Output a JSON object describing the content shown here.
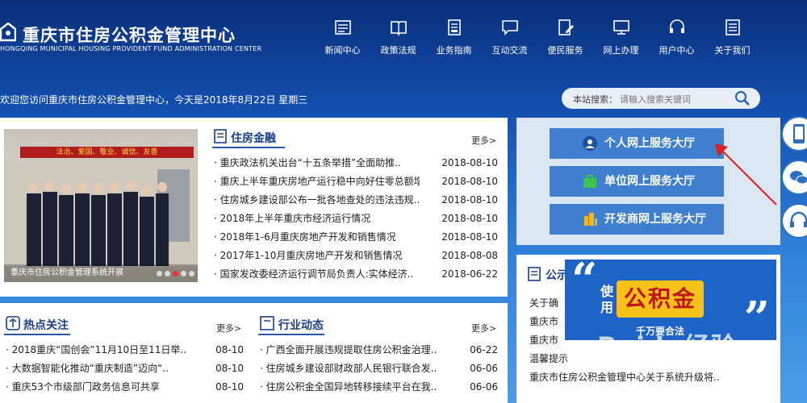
{
  "header": {
    "title_cn": "重庆市住房公积金管理中心",
    "title_en": "HONGQING MUNICIPAL HOUSING PROVIDENT FUND ADMINISTRATION CENTER"
  },
  "nav": [
    "新闻中心",
    "政策法规",
    "业务指南",
    "互动交流",
    "便民服务",
    "网上办理",
    "用户中心",
    "关于我们"
  ],
  "welcome": "欢迎您访问重庆市住房公积金管理中心，今天是2018年8月22日 星期三",
  "search": {
    "label": "本站搜索：",
    "placeholder": "请输入搜索关键词"
  },
  "photo": {
    "banner": "法治、爱国、敬业、诚信、友善",
    "caption": "重庆市住房公积金管理系统开展"
  },
  "finance": {
    "title": "住房金融",
    "more": "更多>",
    "items": [
      {
        "title": "重庆政法机关出台“十五条举措”全面助推..",
        "date": "2018-08-10"
      },
      {
        "title": "重庆上半年重庆房地产运行稳中向好住零总额增长..",
        "date": "2018-08-10"
      },
      {
        "title": "住房城乡建设部公布一批各地查处的违法违规..",
        "date": "2018-08-10"
      },
      {
        "title": "2018年上半年重庆市经济运行情况",
        "date": "2018-08-10"
      },
      {
        "title": "2018年1-6月重庆房地产开发和销售情况",
        "date": "2018-08-10"
      },
      {
        "title": "2017年1-10月重庆房地产开发和销售情况",
        "date": "2018-08-08"
      },
      {
        "title": "国家发改委经济运行调节局负责人:实体经济..",
        "date": "2018-06-22"
      }
    ]
  },
  "hot": {
    "title": "热点关注",
    "more": "更多>",
    "items": [
      {
        "title": "2018重庆“国创会”11月10日至11日举..",
        "date": "08-10"
      },
      {
        "title": "大数据智能化推动“重庆制造”迈向“..",
        "date": "08-10"
      },
      {
        "title": "重庆53个市级部门政务信息可共享",
        "date": "08-10"
      }
    ]
  },
  "industry": {
    "title": "行业动态",
    "more": "更多>",
    "items": [
      {
        "title": "广西全面开展违规提取住房公积金治理..",
        "date": "06-22"
      },
      {
        "title": "住房城乡建设部财政部人民银行联合发..",
        "date": "06-06"
      },
      {
        "title": "住房公积金全国异地转移接续平台在我..",
        "date": "06-06"
      }
    ]
  },
  "services": [
    "个人网上服务大厅",
    "单位网上服务大厅",
    "开发商网上服务大厅"
  ],
  "notice": {
    "title": "公示",
    "items": [
      "关于确",
      "重庆市",
      "重庆市",
      "温馨提示",
      "重庆市住房公积金管理中心关于系统升级将.."
    ]
  },
  "ad": {
    "use": "使用",
    "big": "公积金",
    "sub": "千万要合法"
  },
  "watermark": "Baidu经验",
  "colors": {
    "primary": "#1a3f86",
    "accent": "#3f7fcf",
    "ad_yellow": "#f6c21a"
  }
}
